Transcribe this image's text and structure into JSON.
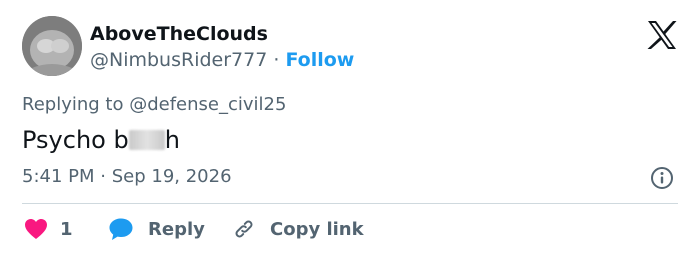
{
  "user": {
    "display_name": "AboveTheClouds",
    "handle": "@NimbusRider777",
    "separator": "·",
    "follow_label": "Follow"
  },
  "reply_context": {
    "prefix": "Replying to",
    "target": "@defense_civil25"
  },
  "tweet": {
    "text_start": "Psycho b",
    "text_end": "h",
    "time": "5:41 PM",
    "separator": "·",
    "date": "Sep 19, 2026"
  },
  "actions": {
    "like_count": "1",
    "reply_label": "Reply",
    "copy_link_label": "Copy link"
  },
  "icons": {
    "logo": "x-logo-icon",
    "info": "info-icon",
    "like": "heart-icon",
    "reply": "speech-bubble-icon",
    "copy": "link-icon"
  },
  "colors": {
    "accent": "#1d9bf0",
    "like": "#f91880",
    "text_primary": "#0f1419",
    "text_secondary": "#536471",
    "divider": "#cfd9de"
  }
}
